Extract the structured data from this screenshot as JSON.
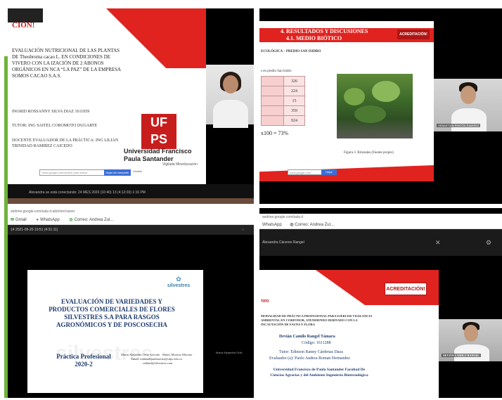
{
  "q1": {
    "badge": "CIÓN!",
    "title": "EVALUACIÓN NUTRICIONAL DE LAS PLANTAS DE Theobroma cacao L. EN CONDICIONES DE VIVERO CON LA IZACIÓN DE 2 ABONOS ORGÁNICOS EN NCA “LA PAZ” DE LA EMPRESA SOMOS CACAO S.A.S.",
    "student": "INGRID ROSSANNY SILVA DIAZ 1611059",
    "tutor": "TUTOR: ING SAITEL COROMOTO DUGARTE",
    "evaluator": "DOCENTE EVALUADOR DE LA PRÁCTICA: ING LILIAN TRINIDAD RAMIREZ CAICEDO",
    "logo": "UF PS",
    "university": "Universidad Francisco Paula Santander",
    "university_sub": "Vigilada Mineducación",
    "search_text": "www.google.com/search para busca",
    "search_button": "Dejar de compartir",
    "search_extra": "Ocultar",
    "status_text": "Alexandra se está conectando: 24 MES 2020 (10:40) 13 (4:12:03) 1:16 PM"
  },
  "q2": {
    "heading1": "4. RESULTADOS Y DISCUSIONES",
    "heading2": "4.1. MEDIO BIÓTICO",
    "acr": "ACREDITACIÓN!",
    "subtitle": "ECOLÓGICA – PREDIO SAN ISIDRO",
    "subtitle2": "s en predio San Isidro",
    "table": [
      {
        "a": "",
        "b": "326"
      },
      {
        "a": "",
        "b": "224"
      },
      {
        "a": "",
        "b": "15"
      },
      {
        "a": "",
        "b": "359"
      },
      {
        "a": "",
        "b": "924"
      }
    ],
    "pct": "x100 = 73%",
    "caption": "Figura 3. Brinzales (Fuente propio)",
    "search_text": "www.google.com",
    "search_button": "Dejar",
    "cam_name": "SEBASTIAN RINCÓN RAMIREZ"
  },
  "q3": {
    "url": "sedrive.google.com/sala d.ado/mnr/saver",
    "tabs": [
      {
        "icon": "✉",
        "label": "Gmail"
      },
      {
        "icon": "●",
        "label": "WhatsApp"
      },
      {
        "icon": "◎",
        "label": "Correo: Andrea Zul..."
      }
    ],
    "title_row": "14 2021-09-20 10:51 (4:31:11)",
    "title_right": "○",
    "watermark": "silvestres",
    "logo": "silvestres",
    "title": "EVALUACIÓN DE VARIEDADES Y PRODUCTOS COMERCIALES DE FLORES SILVESTRES S.A PARA RASGOS AGRONÓMICOS Y DE POSCOSECHA",
    "practica": "Práctica Profesional 2020-2",
    "authors": "María Alejandra Ortiz Arévalo · Mateo Moreno Moreno · Email: mariaalejandraortiz@ufps.edu.co · calidad@silvestres.com",
    "side_name": "María Alejandra Ortiz"
  },
  "q4": {
    "url": "sedrive.google.com/sala d",
    "tabs": [
      {
        "icon": "",
        "label": "WhatsApp"
      },
      {
        "icon": "◎",
        "label": "Correo: Andrea Zul..."
      }
    ],
    "title_row": "Alexandra Cáceres Rangel",
    "close": "✕",
    "gear": "⚙",
    "acr": "ACREDITACIÓN!",
    "label": "TIPO",
    "title": "MODALIDAD DE PRÁCTICA PROFESIONAL PARA EJERCER VIGILANCIA AMBIENTAL EN CORPONOR, ATENDIENDO DERIVADO CON LA INCAUTACIÓN DE FAUNA Y FLORA",
    "name": "Devián Camilo Rangel Támara",
    "code": "Código: 1611288",
    "tutor": "Tutor: Edinson Ranny Cárdenas Daza",
    "evaluator": "Evaluador (a): Paolo Andrea Roman Hernandez",
    "university": "Universidad Francisco de Paula Santander Facultad De Ciencias Agrarias y del Ambiente Ingeniería Biotecnológica",
    "cam_name": "DEVIÁN CAMILO RANGEL"
  },
  "colors": {
    "accent_red": "#e0231f",
    "green_bar": "#6fb43a",
    "navy": "#1d3b6e"
  }
}
